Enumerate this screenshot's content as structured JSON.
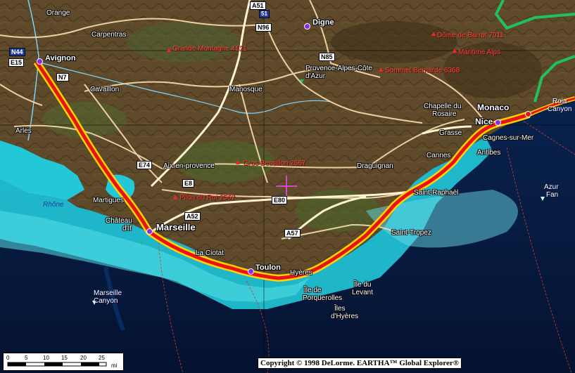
{
  "map": {
    "copyright": "Copyright © 1998 DeLorme.  EARTHA™ Global Explorer®",
    "scale": {
      "ticks": [
        "0",
        "5",
        "10",
        "15",
        "20",
        "25"
      ],
      "unit": "mi"
    },
    "highways": [
      {
        "id": "A51",
        "label": "A51",
        "style": "white"
      },
      {
        "id": "blue-shield",
        "label": "51",
        "style": "blue"
      },
      {
        "id": "N96",
        "label": "N96",
        "style": "white"
      },
      {
        "id": "N44",
        "label": "N44",
        "style": "blue"
      },
      {
        "id": "E15",
        "label": "E15",
        "style": "white"
      },
      {
        "id": "N7",
        "label": "N7",
        "style": "white"
      },
      {
        "id": "N85",
        "label": "N85",
        "style": "white"
      },
      {
        "id": "E74",
        "label": "E74",
        "style": "white"
      },
      {
        "id": "E8",
        "label": "E8",
        "style": "white"
      },
      {
        "id": "E80",
        "label": "E80",
        "style": "white"
      },
      {
        "id": "A52",
        "label": "A52",
        "style": "white"
      },
      {
        "id": "A57",
        "label": "A57",
        "style": "white"
      }
    ],
    "cities": [
      {
        "id": "orange",
        "label": "Orange"
      },
      {
        "id": "carpentras",
        "label": "Carpentras"
      },
      {
        "id": "avignon",
        "label": "Avignon"
      },
      {
        "id": "cavaillon",
        "label": "Cavaillon"
      },
      {
        "id": "arles",
        "label": "Arles"
      },
      {
        "id": "manosque",
        "label": "Manosque"
      },
      {
        "id": "digne",
        "label": "Digne"
      },
      {
        "id": "pac1",
        "label": "Provence-Alpes-Côte"
      },
      {
        "id": "pac2",
        "label": "d'Azur"
      },
      {
        "id": "aix",
        "label": "Aix-en-provence"
      },
      {
        "id": "martigues",
        "label": "Martigues"
      },
      {
        "id": "chateau1",
        "label": "Château"
      },
      {
        "id": "chateau2",
        "label": "d'If"
      },
      {
        "id": "marseille",
        "label": "Marseille"
      },
      {
        "id": "laciotat",
        "label": "La Ciotat"
      },
      {
        "id": "toulon",
        "label": "Toulon"
      },
      {
        "id": "hyeres",
        "label": "Hyères"
      },
      {
        "id": "draguignan",
        "label": "Draguignan"
      },
      {
        "id": "straphael",
        "label": "Saint-Raphaël"
      },
      {
        "id": "sttropez",
        "label": "Saint-Tropez"
      },
      {
        "id": "cannes",
        "label": "Cannes"
      },
      {
        "id": "antibes",
        "label": "Antibes"
      },
      {
        "id": "grasse",
        "label": "Grasse"
      },
      {
        "id": "nice",
        "label": "Nice"
      },
      {
        "id": "monaco",
        "label": "Monaco"
      },
      {
        "id": "cagnes",
        "label": "Cagnes-sur-Mer"
      },
      {
        "id": "chapelle1",
        "label": "Chapelle du"
      },
      {
        "id": "chapelle2",
        "label": "Rosaire"
      },
      {
        "id": "ileporq1",
        "label": "Île de"
      },
      {
        "id": "ileporq2",
        "label": "Porquerolles"
      },
      {
        "id": "ilelev1",
        "label": "Île du"
      },
      {
        "id": "ilelev2",
        "label": "Levant"
      },
      {
        "id": "ileshy1",
        "label": "Îles"
      },
      {
        "id": "ileshy2",
        "label": "d'Hyères"
      }
    ],
    "peaks": [
      {
        "id": "grande-montagne",
        "label": "Grande Montagne 4121"
      },
      {
        "id": "dome-barrot",
        "label": "Dôme de Barrot 7011"
      },
      {
        "id": "maritime-alps",
        "label": "Maritime Alps"
      },
      {
        "id": "sommet-bernarde",
        "label": "Sommet Bernarde 6368"
      },
      {
        "id": "gros-bessillon",
        "label": "Gros Bessillon 2667"
      },
      {
        "id": "pilon-du-roi",
        "label": "Pilon du Roi 2562"
      }
    ],
    "water": [
      {
        "id": "rhone",
        "label": "Rhône"
      },
      {
        "id": "marseille-canyon-1",
        "label": "Marseille"
      },
      {
        "id": "marseille-canyon-2",
        "label": "Canyon"
      },
      {
        "id": "azur-fan-1",
        "label": "Azur"
      },
      {
        "id": "azur-fan-2",
        "label": "Fan"
      },
      {
        "id": "roia-1",
        "label": "Roia"
      },
      {
        "id": "roia-2",
        "label": "Canyon"
      }
    ]
  },
  "colors": {
    "land": "#5e4a2a",
    "land_green": "#3f5a2a",
    "shallow_sea": "#22c8d8",
    "deep_sea": "#06163a",
    "major_road": "#e81414",
    "road_casing": "#ffd400",
    "minor_road": "#f4d6a8",
    "border": "#20c060",
    "peak": "#ff3a3a"
  }
}
